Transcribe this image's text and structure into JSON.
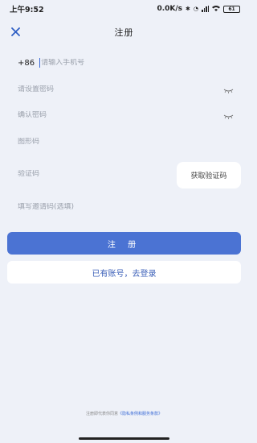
{
  "status_bar": {
    "time": "上午9:52",
    "network_speed": "0.0K/s",
    "battery": "61"
  },
  "header": {
    "title": "注册",
    "close_icon": "close-icon"
  },
  "form": {
    "country_code": "+86",
    "phone_placeholder": "请输入手机号",
    "password_placeholder": "请设置密码",
    "confirm_password_placeholder": "确认密码",
    "captcha_placeholder": "图形码",
    "verify_code_placeholder": "验证码",
    "get_code_label": "获取验证码",
    "invite_code_placeholder": "填写邀请码(选填)"
  },
  "actions": {
    "register_label": "注 册",
    "login_label": "已有账号，去登录"
  },
  "footer": {
    "agreement_text": "注册即代表你同意",
    "agreement_link": "《隐私条例和服务条款》"
  },
  "colors": {
    "primary": "#4b73d3",
    "background": "#eef1f8"
  }
}
